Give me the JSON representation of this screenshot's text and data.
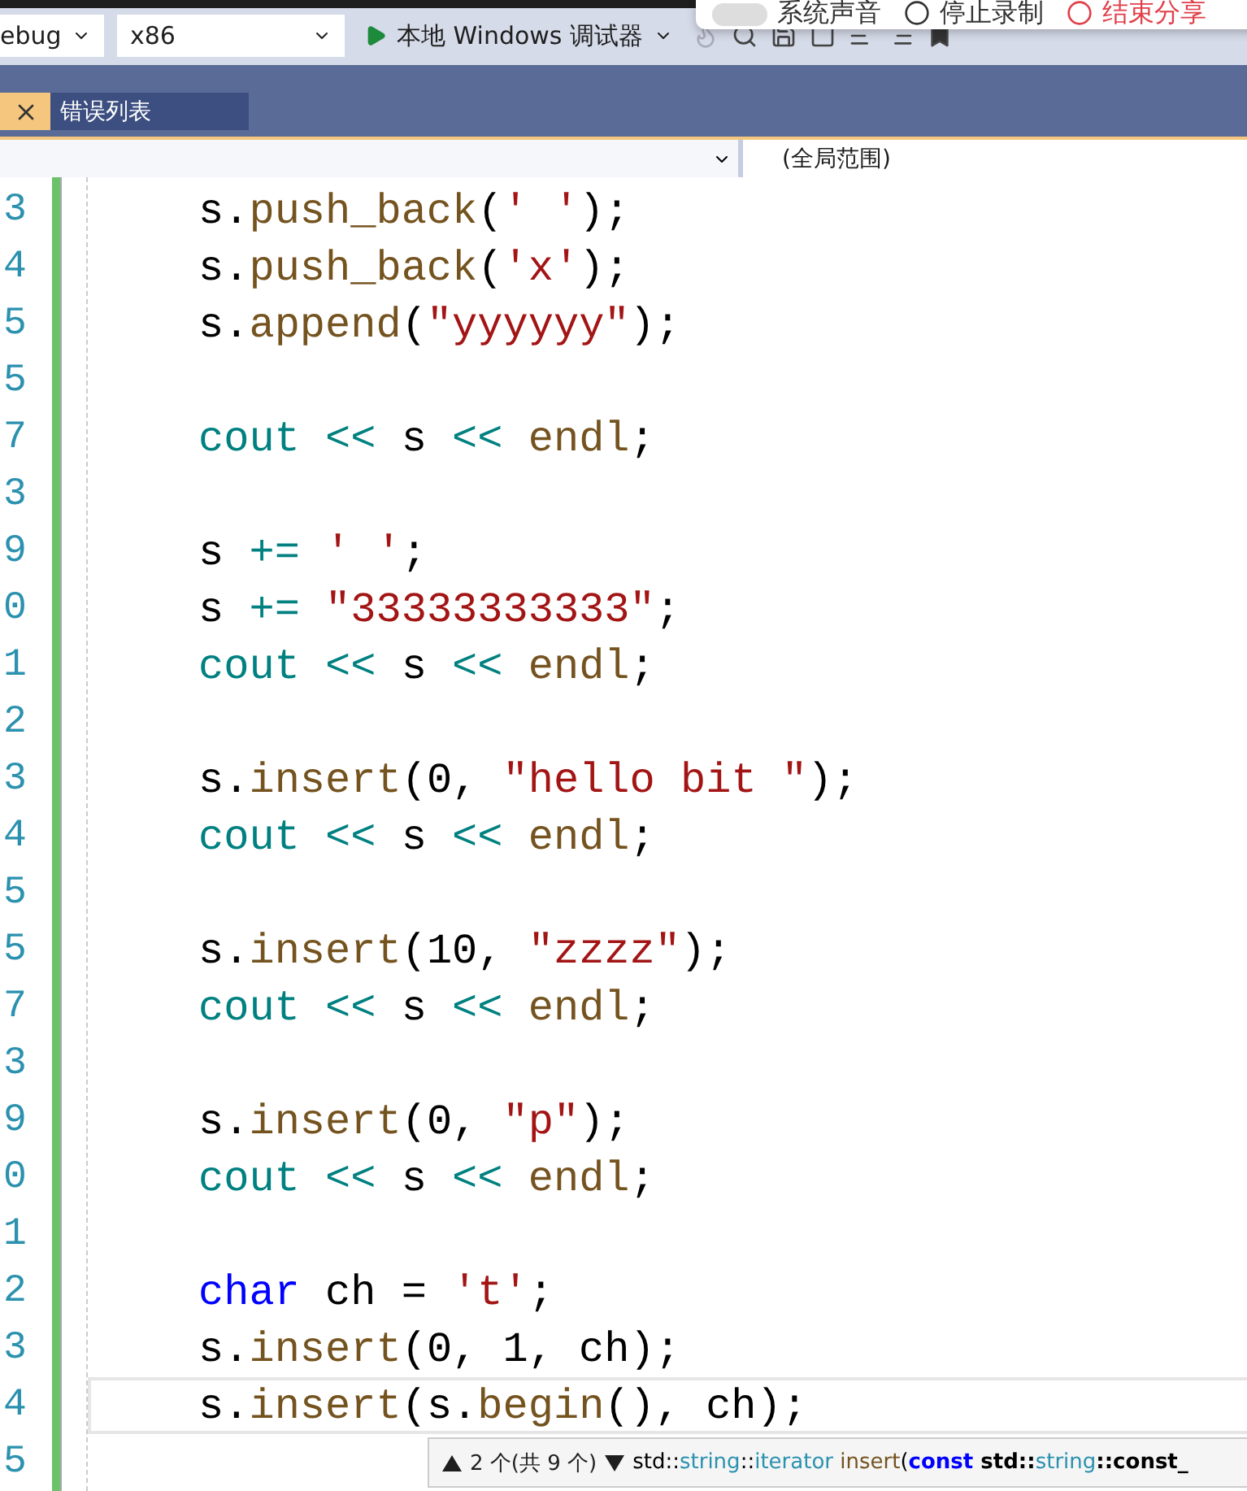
{
  "toolbar": {
    "configuration": "ebug",
    "platform": "x86",
    "debugger": "本地 Windows 调试器"
  },
  "recording_bar": {
    "items": [
      {
        "kind": "toggle",
        "label": "系统声音",
        "on": false
      },
      {
        "kind": "stop",
        "label": "停止录制"
      },
      {
        "kind": "end",
        "label": "结束分享"
      }
    ]
  },
  "tabs": [
    {
      "label": "错误列表",
      "selected": false
    }
  ],
  "navigation_bar": {
    "scope": "(全局范围)"
  },
  "code_lines": [
    {
      "number": "3",
      "tokens": [
        {
          "text": "s",
          "kind": "plain"
        },
        {
          "text": ".",
          "kind": "plain"
        },
        {
          "text": "push_back",
          "kind": "method"
        },
        {
          "text": "(",
          "kind": "plain"
        },
        {
          "text": "' '",
          "kind": "string"
        },
        {
          "text": ");",
          "kind": "plain"
        }
      ]
    },
    {
      "number": "4",
      "tokens": [
        {
          "text": "s",
          "kind": "plain"
        },
        {
          "text": ".",
          "kind": "plain"
        },
        {
          "text": "push_back",
          "kind": "method"
        },
        {
          "text": "(",
          "kind": "plain"
        },
        {
          "text": "'x'",
          "kind": "string"
        },
        {
          "text": ");",
          "kind": "plain"
        }
      ]
    },
    {
      "number": "5",
      "tokens": [
        {
          "text": "s",
          "kind": "plain"
        },
        {
          "text": ".",
          "kind": "plain"
        },
        {
          "text": "append",
          "kind": "method"
        },
        {
          "text": "(",
          "kind": "plain"
        },
        {
          "text": "\"yyyyyy\"",
          "kind": "string"
        },
        {
          "text": ");",
          "kind": "plain"
        }
      ]
    },
    {
      "number": "5"
    },
    {
      "number": "7",
      "tokens": [
        {
          "text": "cout",
          "kind": "stream"
        },
        {
          "text": " << ",
          "kind": "operator"
        },
        {
          "text": "s",
          "kind": "plain"
        },
        {
          "text": " << ",
          "kind": "operator"
        },
        {
          "text": "endl",
          "kind": "method"
        },
        {
          "text": ";",
          "kind": "plain"
        }
      ]
    },
    {
      "number": "3"
    },
    {
      "number": "9",
      "tokens": [
        {
          "text": "s",
          "kind": "plain"
        },
        {
          "text": " += ",
          "kind": "operator"
        },
        {
          "text": "' '",
          "kind": "string"
        },
        {
          "text": ";",
          "kind": "plain"
        }
      ]
    },
    {
      "number": "0",
      "tokens": [
        {
          "text": "s",
          "kind": "plain"
        },
        {
          "text": " += ",
          "kind": "operator"
        },
        {
          "text": "\"33333333333\"",
          "kind": "string"
        },
        {
          "text": ";",
          "kind": "plain"
        }
      ]
    },
    {
      "number": "1",
      "tokens": [
        {
          "text": "cout",
          "kind": "stream"
        },
        {
          "text": " << ",
          "kind": "operator"
        },
        {
          "text": "s",
          "kind": "plain"
        },
        {
          "text": " << ",
          "kind": "operator"
        },
        {
          "text": "endl",
          "kind": "method"
        },
        {
          "text": ";",
          "kind": "plain"
        }
      ]
    },
    {
      "number": "2"
    },
    {
      "number": "3",
      "tokens": [
        {
          "text": "s",
          "kind": "plain"
        },
        {
          "text": ".",
          "kind": "plain"
        },
        {
          "text": "insert",
          "kind": "method"
        },
        {
          "text": "(0, ",
          "kind": "plain"
        },
        {
          "text": "\"hello bit \"",
          "kind": "string"
        },
        {
          "text": ");",
          "kind": "plain"
        }
      ]
    },
    {
      "number": "4",
      "tokens": [
        {
          "text": "cout",
          "kind": "stream"
        },
        {
          "text": " << ",
          "kind": "operator"
        },
        {
          "text": "s",
          "kind": "plain"
        },
        {
          "text": " << ",
          "kind": "operator"
        },
        {
          "text": "endl",
          "kind": "method"
        },
        {
          "text": ";",
          "kind": "plain"
        }
      ]
    },
    {
      "number": "5"
    },
    {
      "number": "5",
      "tokens": [
        {
          "text": "s",
          "kind": "plain"
        },
        {
          "text": ".",
          "kind": "plain"
        },
        {
          "text": "insert",
          "kind": "method"
        },
        {
          "text": "(10, ",
          "kind": "plain"
        },
        {
          "text": "\"zzzz\"",
          "kind": "string"
        },
        {
          "text": ");",
          "kind": "plain"
        }
      ]
    },
    {
      "number": "7",
      "tokens": [
        {
          "text": "cout",
          "kind": "stream"
        },
        {
          "text": " << ",
          "kind": "operator"
        },
        {
          "text": "s",
          "kind": "plain"
        },
        {
          "text": " << ",
          "kind": "operator"
        },
        {
          "text": "endl",
          "kind": "method"
        },
        {
          "text": ";",
          "kind": "plain"
        }
      ]
    },
    {
      "number": "3"
    },
    {
      "number": "9",
      "tokens": [
        {
          "text": "s",
          "kind": "plain"
        },
        {
          "text": ".",
          "kind": "plain"
        },
        {
          "text": "insert",
          "kind": "method"
        },
        {
          "text": "(0, ",
          "kind": "plain"
        },
        {
          "text": "\"p\"",
          "kind": "string"
        },
        {
          "text": ");",
          "kind": "plain"
        }
      ]
    },
    {
      "number": "0",
      "tokens": [
        {
          "text": "cout",
          "kind": "stream"
        },
        {
          "text": " << ",
          "kind": "operator"
        },
        {
          "text": "s",
          "kind": "plain"
        },
        {
          "text": " << ",
          "kind": "operator"
        },
        {
          "text": "endl",
          "kind": "method"
        },
        {
          "text": ";",
          "kind": "plain"
        }
      ]
    },
    {
      "number": "1"
    },
    {
      "number": "2",
      "tokens": [
        {
          "text": "char",
          "kind": "keyword"
        },
        {
          "text": " ch = ",
          "kind": "plain"
        },
        {
          "text": "'t'",
          "kind": "string"
        },
        {
          "text": ";",
          "kind": "plain"
        }
      ]
    },
    {
      "number": "3",
      "tokens": [
        {
          "text": "s",
          "kind": "plain"
        },
        {
          "text": ".",
          "kind": "plain"
        },
        {
          "text": "insert",
          "kind": "method"
        },
        {
          "text": "(0, 1, ch);",
          "kind": "plain"
        }
      ]
    },
    {
      "number": "4",
      "current": true,
      "tokens": [
        {
          "text": "s",
          "kind": "plain"
        },
        {
          "text": ".",
          "kind": "plain"
        },
        {
          "text": "insert",
          "kind": "method"
        },
        {
          "text": "(s.",
          "kind": "plain"
        },
        {
          "text": "begin",
          "kind": "method"
        },
        {
          "text": "(), ch);",
          "kind": "plain"
        }
      ]
    },
    {
      "number": "5"
    }
  ],
  "signature_tooltip": {
    "counter": "2 个(共 9 个)",
    "tokens": [
      {
        "text": "std::",
        "kind": "plain"
      },
      {
        "text": "string",
        "kind": "type"
      },
      {
        "text": "::",
        "kind": "plain"
      },
      {
        "text": "iterator",
        "kind": "type"
      },
      {
        "text": " insert",
        "kind": "method"
      },
      {
        "text": "(",
        "kind": "plain"
      },
      {
        "text": "const",
        "kind": "keyword"
      },
      {
        "text": " std::",
        "kind": "bold"
      },
      {
        "text": "string",
        "kind": "type"
      },
      {
        "text": "::const_",
        "kind": "bold"
      }
    ]
  }
}
